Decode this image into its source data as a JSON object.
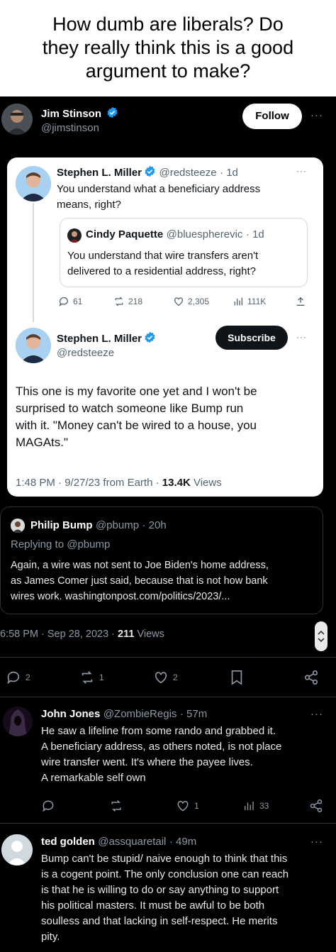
{
  "caption": {
    "line1": "How dumb are liberals? Do",
    "line2": "they really think this is a good",
    "line3": "argument to make?"
  },
  "main_tweet": {
    "name": "Jim Stinson",
    "handle": "@jimstinson",
    "follow_label": "Follow",
    "more": "···",
    "card": {
      "reply": {
        "name": "Stephen L. Miller",
        "handle": "@redsteeze",
        "time": "· 1d",
        "text_line1": "You understand what a beneficiary address",
        "text_line2": "means, right?",
        "more": "···",
        "quote": {
          "name": "Cindy Paquette",
          "handle": "@bluespherevic",
          "time": "· 1d",
          "text_line1": "You understand that wire transfers aren't",
          "text_line2": "delivered to a residential address, right?"
        },
        "stats": {
          "replies": "61",
          "reposts": "218",
          "likes": "2,305",
          "views": "111K"
        }
      },
      "main": {
        "name": "Stephen L. Miller",
        "handle": "@redsteeze",
        "subscribe_label": "Subscribe",
        "more": "···",
        "text_line1": "This one is my favorite one yet and I won't be",
        "text_line2": "surprised to watch someone like Bump run",
        "text_line3": "with it. \"Money can't be wired to a house, you",
        "text_line4": "MAGAts.\"",
        "meta_time": "1:48 PM · 9/27/23 from Earth ·",
        "meta_views_count": "13.4K",
        "meta_views_label": "Views"
      }
    },
    "quoted_reply": {
      "name": "Philip Bump",
      "handle": "@pbump",
      "time": "· 20h",
      "replying_to": "Replying to @pbump",
      "text_line1": "Again, a wire was not sent to Joe Biden's home address,",
      "text_line2": "as James Comer just said, because that is not how bank",
      "text_line3": "wires work. washingtonpost.com/politics/2023/..."
    },
    "meta": {
      "time": "6:58 PM · Sep 28, 2023 ·",
      "views_count": "211",
      "views_label": "Views"
    },
    "actions": {
      "replies": "2",
      "reposts": "1",
      "likes": "2"
    }
  },
  "replies": [
    {
      "name": "John Jones",
      "handle": "@ZombieRegis",
      "time": "· 57m",
      "line1": "He saw a lifeline from some rando and grabbed it.",
      "line2": "A beneficiary address, as others noted, is not place",
      "line3": "wire transfer went. It's where the payee lives.",
      "line4": "A remarkable self own",
      "likes": "1",
      "views": "33"
    },
    {
      "name": "ted golden",
      "handle": "@assquaretail",
      "time": "· 49m",
      "line1": "Bump can't be stupid/ naive enough to think that this",
      "line2": "is a cogent point.  The only conclusion one can reach",
      "line3": "is that he is willing to do or say anything to support",
      "line4": "his political masters.  It must be awful to be both",
      "line5": "soulless and that lacking in self-respect.  He merits",
      "line6": "pity."
    }
  ],
  "colors": {
    "verified": "#1d9bf0",
    "muted": "#8b98a5",
    "card_bg": "#ffffff"
  }
}
